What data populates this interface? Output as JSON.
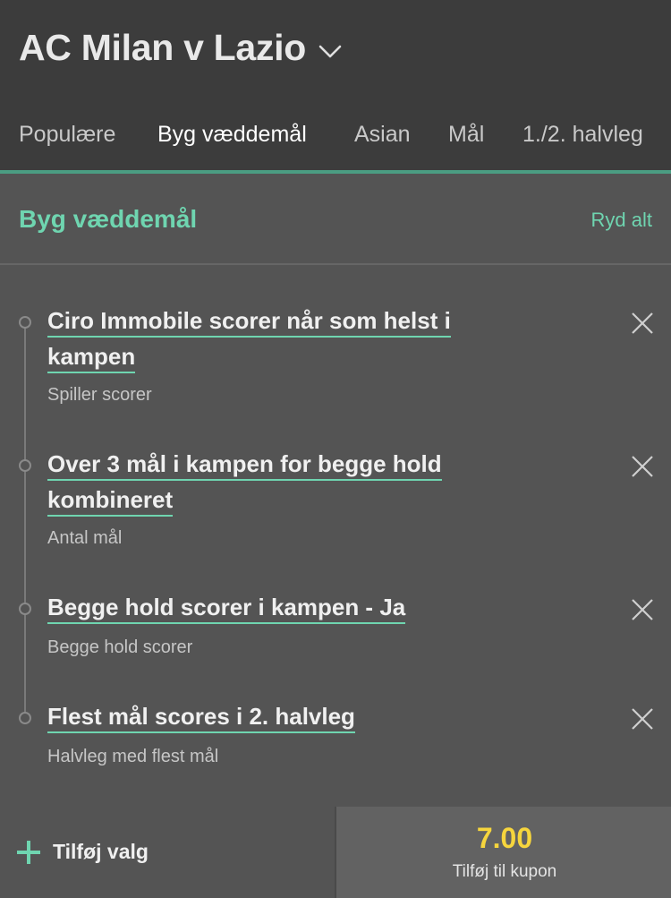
{
  "header": {
    "match_title": "AC Milan v Lazio",
    "dropdown_icon": "chevron-down-icon"
  },
  "tabs": [
    {
      "label": "Populære",
      "active": false
    },
    {
      "label": "Byg væddemål",
      "active": true
    },
    {
      "label": "Asian",
      "active": false
    },
    {
      "label": "Mål",
      "active": false
    },
    {
      "label": "1./2. halvleg",
      "active": false
    }
  ],
  "builder": {
    "title": "Byg væddemål",
    "clear_all_label": "Ryd alt"
  },
  "selections": [
    {
      "title_line1": "Ciro Immobile scorer når som helst i",
      "title_line2": "kampen",
      "market": "Spiller scorer"
    },
    {
      "title_line1": "Over 3 mål i kampen for begge hold",
      "title_line2": "kombineret",
      "market": "Antal mål"
    },
    {
      "title_line1": "Begge hold scorer i kampen - Ja",
      "market": "Begge hold scorer"
    },
    {
      "title_line1": "Flest mål scores i 2. halvleg",
      "market": "Halvleg med flest mål"
    }
  ],
  "footer": {
    "add_selection_label": "Tilføj valg",
    "odds": "7.00",
    "add_to_coupon_label": "Tilføj til kupon"
  },
  "colors": {
    "accent": "#6fd5b0",
    "odds": "#f6d53d",
    "header_bg": "#3c3c3c",
    "body_bg": "#545454"
  }
}
